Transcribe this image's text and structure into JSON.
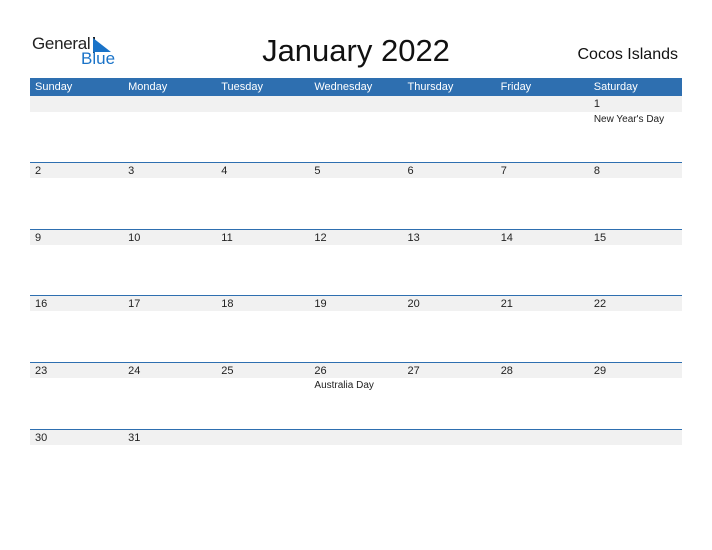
{
  "logo": {
    "word1": "General",
    "word2": "Blue"
  },
  "title": "January 2022",
  "country": "Cocos Islands",
  "colors": {
    "accent": "#2e6fb0",
    "band": "#f1f1f1"
  },
  "weekdays": [
    "Sunday",
    "Monday",
    "Tuesday",
    "Wednesday",
    "Thursday",
    "Friday",
    "Saturday"
  ],
  "weeks": [
    [
      {
        "day": ""
      },
      {
        "day": ""
      },
      {
        "day": ""
      },
      {
        "day": ""
      },
      {
        "day": ""
      },
      {
        "day": ""
      },
      {
        "day": "1",
        "holiday": "New Year's Day"
      }
    ],
    [
      {
        "day": "2"
      },
      {
        "day": "3"
      },
      {
        "day": "4"
      },
      {
        "day": "5"
      },
      {
        "day": "6"
      },
      {
        "day": "7"
      },
      {
        "day": "8"
      }
    ],
    [
      {
        "day": "9"
      },
      {
        "day": "10"
      },
      {
        "day": "11"
      },
      {
        "day": "12"
      },
      {
        "day": "13"
      },
      {
        "day": "14"
      },
      {
        "day": "15"
      }
    ],
    [
      {
        "day": "16"
      },
      {
        "day": "17"
      },
      {
        "day": "18"
      },
      {
        "day": "19"
      },
      {
        "day": "20"
      },
      {
        "day": "21"
      },
      {
        "day": "22"
      }
    ],
    [
      {
        "day": "23"
      },
      {
        "day": "24"
      },
      {
        "day": "25"
      },
      {
        "day": "26",
        "holiday": "Australia Day"
      },
      {
        "day": "27"
      },
      {
        "day": "28"
      },
      {
        "day": "29"
      }
    ],
    [
      {
        "day": "30"
      },
      {
        "day": "31"
      },
      {
        "day": ""
      },
      {
        "day": ""
      },
      {
        "day": ""
      },
      {
        "day": ""
      },
      {
        "day": ""
      }
    ]
  ]
}
